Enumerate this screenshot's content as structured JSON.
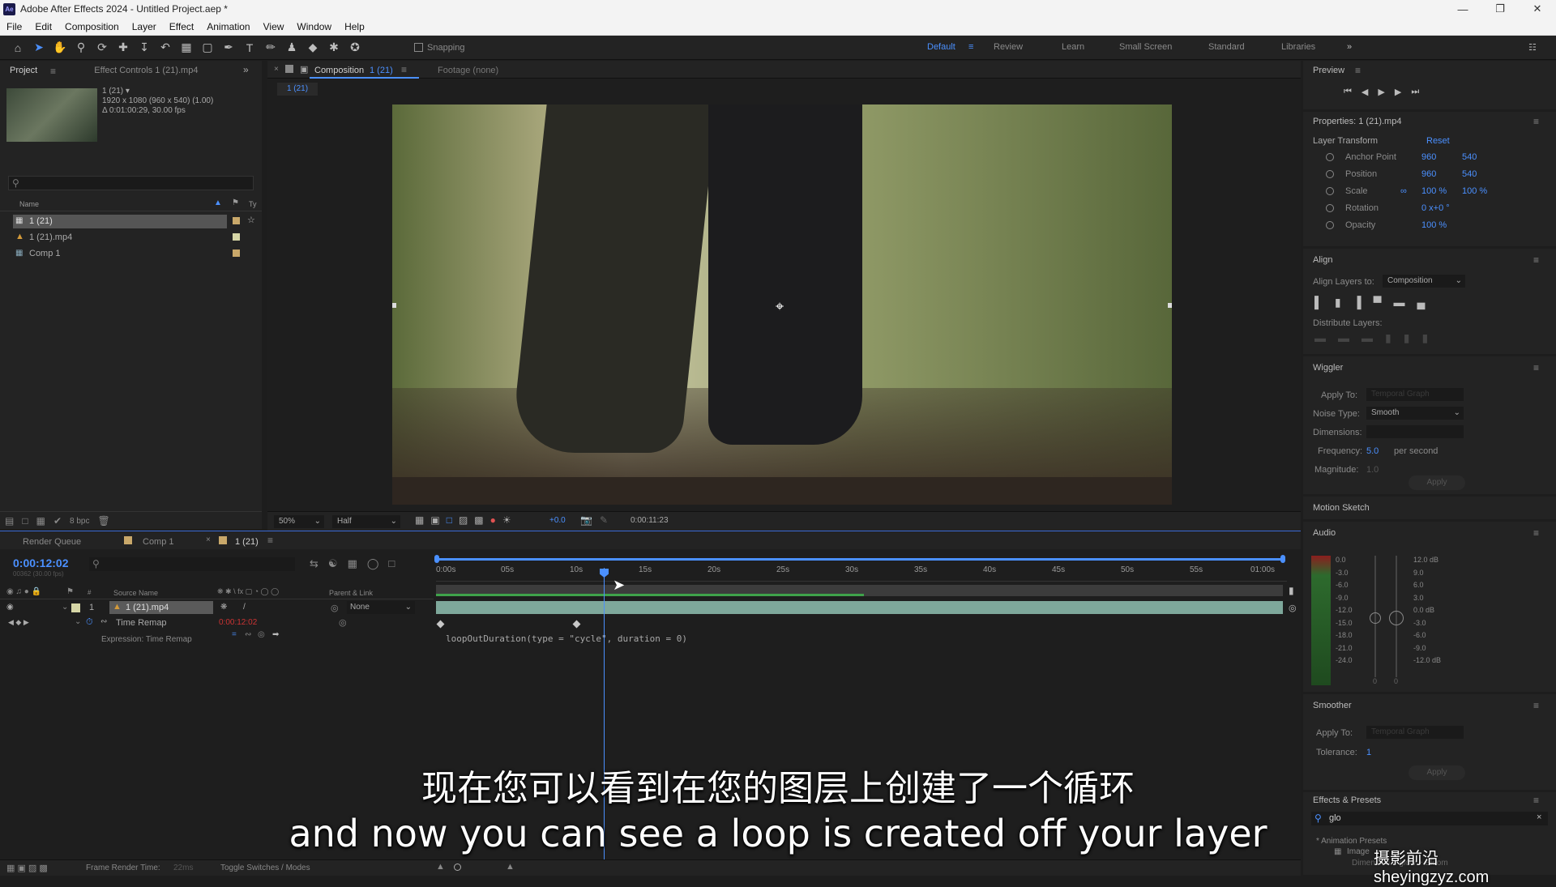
{
  "window": {
    "title": "Adobe After Effects 2024 - Untitled Project.aep *",
    "logo": "Ae"
  },
  "menu": [
    "File",
    "Edit",
    "Composition",
    "Layer",
    "Effect",
    "Animation",
    "View",
    "Window",
    "Help"
  ],
  "toolbar": {
    "snapping": "Snapping"
  },
  "workspaces": [
    "Default",
    "Review",
    "Learn",
    "Small Screen",
    "Standard",
    "Libraries"
  ],
  "project": {
    "tabs": [
      "Project",
      "Effect Controls 1 (21).mp4"
    ],
    "info": {
      "name": "1 (21) ▾",
      "res": "1920 x 1080 (960 x 540) (1.00)",
      "dur": "Δ 0:01:00:29, 30.00 fps"
    },
    "col_name": "Name",
    "col_type": "Ty",
    "items": [
      "1 (21)",
      "1 (21).mp4",
      "Comp 1"
    ],
    "bpc": "8 bpc"
  },
  "comp": {
    "tab": "Composition",
    "tab_name": "1 (21)",
    "footage": "Footage (none)",
    "subtab": "1 (21)",
    "zoom": "50%",
    "resolution": "Half",
    "exposure": "+0.0",
    "timecode": "0:00:11:23"
  },
  "timeline": {
    "tabs": [
      "Render Queue",
      "Comp 1",
      "1 (21)"
    ],
    "current_time": "0:00:12:02",
    "frame_info": "00362 (30.00 fps)",
    "cols": {
      "num": "#",
      "source": "Source Name",
      "parent": "Parent & Link"
    },
    "ruler": [
      "0:00s",
      "05s",
      "10s",
      "15s",
      "20s",
      "25s",
      "30s",
      "35s",
      "40s",
      "45s",
      "50s",
      "55s",
      "01:00s"
    ],
    "layer": {
      "num": "1",
      "name": "1 (21).mp4",
      "parent": "None"
    },
    "time_remap": "Time Remap",
    "time_remap_value": "0:00:12:02",
    "expr_label": "Expression: Time Remap",
    "expression": "loopOutDuration(type = \"cycle\", duration = 0)",
    "frame_render": "Frame Render Time:",
    "frame_render_val": "22ms",
    "toggle": "Toggle Switches / Modes"
  },
  "preview": {
    "title": "Preview"
  },
  "properties": {
    "title": "Properties: 1 (21).mp4",
    "section": "Layer Transform",
    "reset": "Reset",
    "rows": [
      {
        "label": "Anchor Point",
        "v1": "960",
        "v2": "540"
      },
      {
        "label": "Position",
        "v1": "960",
        "v2": "540"
      },
      {
        "label": "Scale",
        "v1": "100 %",
        "v2": "100 %"
      },
      {
        "label": "Rotation",
        "v1": "0 x+0 °",
        "v2": ""
      },
      {
        "label": "Opacity",
        "v1": "100 %",
        "v2": ""
      }
    ]
  },
  "align": {
    "title": "Align",
    "align_to_label": "Align Layers to:",
    "align_to": "Composition",
    "distribute": "Distribute Layers:"
  },
  "wiggler": {
    "title": "Wiggler",
    "apply_to": "Apply To:",
    "apply_to_val": "Temporal Graph",
    "noise_type": "Noise Type:",
    "noise_val": "Smooth",
    "dimensions": "Dimensions:",
    "frequency": "Frequency:",
    "freq_val": "5.0",
    "per_second": "per second",
    "magnitude": "Magnitude:",
    "mag_val": "1.0",
    "apply": "Apply"
  },
  "motion_sketch": "Motion Sketch",
  "audio": {
    "title": "Audio",
    "left_scale": [
      "0.0",
      "-3.0",
      "-6.0",
      "-9.0",
      "-12.0",
      "-15.0",
      "-18.0",
      "-21.0",
      "-24.0"
    ],
    "right_scale": [
      "12.0 dB",
      "9.0",
      "6.0",
      "3.0",
      "0.0 dB",
      "-3.0",
      "-6.0",
      "-9.0",
      "-12.0 dB"
    ],
    "knob_left": "0",
    "knob_right": "0"
  },
  "smoother": {
    "title": "Smoother",
    "apply_to": "Apply To:",
    "apply_to_val": "Temporal Graph",
    "tolerance": "Tolerance:",
    "tol_val": "1",
    "apply": "Apply"
  },
  "effects": {
    "title": "Effects & Presets",
    "search": "glo",
    "animation_presets": "* Animation Presets",
    "image": "Image",
    "dimension": "Dimension... glow + Bloom"
  },
  "subtitles": {
    "cn": "现在您可以看到在您的图层上创建了一个循环",
    "en": "and now you can see a loop is created off your layer"
  },
  "watermark": "摄影前沿 sheyingzyz.com",
  "colors": {
    "accent": "#4b90ff",
    "panel": "#232323",
    "bg": "#1d1d1d",
    "layer_bar": "#7ea89b"
  }
}
